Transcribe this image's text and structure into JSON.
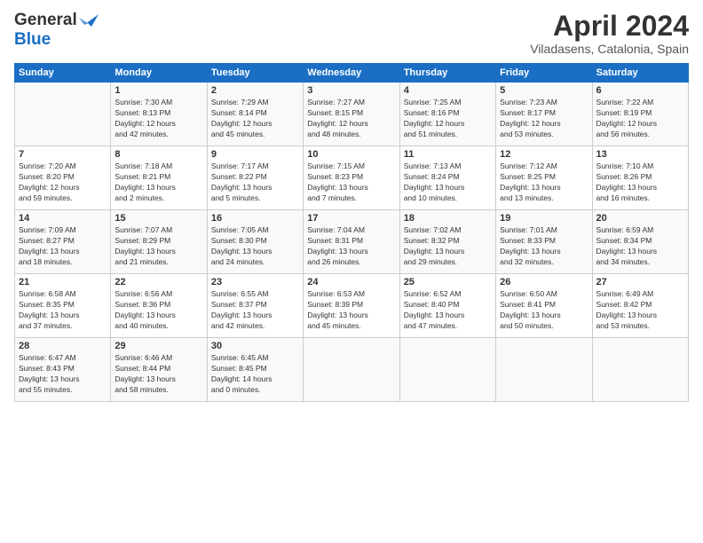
{
  "header": {
    "logo_general": "General",
    "logo_blue": "Blue",
    "month": "April 2024",
    "location": "Viladasens, Catalonia, Spain"
  },
  "days_of_week": [
    "Sunday",
    "Monday",
    "Tuesday",
    "Wednesday",
    "Thursday",
    "Friday",
    "Saturday"
  ],
  "weeks": [
    [
      {
        "day": "",
        "info": ""
      },
      {
        "day": "1",
        "info": "Sunrise: 7:30 AM\nSunset: 8:13 PM\nDaylight: 12 hours\nand 42 minutes."
      },
      {
        "day": "2",
        "info": "Sunrise: 7:29 AM\nSunset: 8:14 PM\nDaylight: 12 hours\nand 45 minutes."
      },
      {
        "day": "3",
        "info": "Sunrise: 7:27 AM\nSunset: 8:15 PM\nDaylight: 12 hours\nand 48 minutes."
      },
      {
        "day": "4",
        "info": "Sunrise: 7:25 AM\nSunset: 8:16 PM\nDaylight: 12 hours\nand 51 minutes."
      },
      {
        "day": "5",
        "info": "Sunrise: 7:23 AM\nSunset: 8:17 PM\nDaylight: 12 hours\nand 53 minutes."
      },
      {
        "day": "6",
        "info": "Sunrise: 7:22 AM\nSunset: 8:19 PM\nDaylight: 12 hours\nand 56 minutes."
      }
    ],
    [
      {
        "day": "7",
        "info": "Sunrise: 7:20 AM\nSunset: 8:20 PM\nDaylight: 12 hours\nand 59 minutes."
      },
      {
        "day": "8",
        "info": "Sunrise: 7:18 AM\nSunset: 8:21 PM\nDaylight: 13 hours\nand 2 minutes."
      },
      {
        "day": "9",
        "info": "Sunrise: 7:17 AM\nSunset: 8:22 PM\nDaylight: 13 hours\nand 5 minutes."
      },
      {
        "day": "10",
        "info": "Sunrise: 7:15 AM\nSunset: 8:23 PM\nDaylight: 13 hours\nand 7 minutes."
      },
      {
        "day": "11",
        "info": "Sunrise: 7:13 AM\nSunset: 8:24 PM\nDaylight: 13 hours\nand 10 minutes."
      },
      {
        "day": "12",
        "info": "Sunrise: 7:12 AM\nSunset: 8:25 PM\nDaylight: 13 hours\nand 13 minutes."
      },
      {
        "day": "13",
        "info": "Sunrise: 7:10 AM\nSunset: 8:26 PM\nDaylight: 13 hours\nand 16 minutes."
      }
    ],
    [
      {
        "day": "14",
        "info": "Sunrise: 7:09 AM\nSunset: 8:27 PM\nDaylight: 13 hours\nand 18 minutes."
      },
      {
        "day": "15",
        "info": "Sunrise: 7:07 AM\nSunset: 8:29 PM\nDaylight: 13 hours\nand 21 minutes."
      },
      {
        "day": "16",
        "info": "Sunrise: 7:05 AM\nSunset: 8:30 PM\nDaylight: 13 hours\nand 24 minutes."
      },
      {
        "day": "17",
        "info": "Sunrise: 7:04 AM\nSunset: 8:31 PM\nDaylight: 13 hours\nand 26 minutes."
      },
      {
        "day": "18",
        "info": "Sunrise: 7:02 AM\nSunset: 8:32 PM\nDaylight: 13 hours\nand 29 minutes."
      },
      {
        "day": "19",
        "info": "Sunrise: 7:01 AM\nSunset: 8:33 PM\nDaylight: 13 hours\nand 32 minutes."
      },
      {
        "day": "20",
        "info": "Sunrise: 6:59 AM\nSunset: 8:34 PM\nDaylight: 13 hours\nand 34 minutes."
      }
    ],
    [
      {
        "day": "21",
        "info": "Sunrise: 6:58 AM\nSunset: 8:35 PM\nDaylight: 13 hours\nand 37 minutes."
      },
      {
        "day": "22",
        "info": "Sunrise: 6:56 AM\nSunset: 8:36 PM\nDaylight: 13 hours\nand 40 minutes."
      },
      {
        "day": "23",
        "info": "Sunrise: 6:55 AM\nSunset: 8:37 PM\nDaylight: 13 hours\nand 42 minutes."
      },
      {
        "day": "24",
        "info": "Sunrise: 6:53 AM\nSunset: 8:39 PM\nDaylight: 13 hours\nand 45 minutes."
      },
      {
        "day": "25",
        "info": "Sunrise: 6:52 AM\nSunset: 8:40 PM\nDaylight: 13 hours\nand 47 minutes."
      },
      {
        "day": "26",
        "info": "Sunrise: 6:50 AM\nSunset: 8:41 PM\nDaylight: 13 hours\nand 50 minutes."
      },
      {
        "day": "27",
        "info": "Sunrise: 6:49 AM\nSunset: 8:42 PM\nDaylight: 13 hours\nand 53 minutes."
      }
    ],
    [
      {
        "day": "28",
        "info": "Sunrise: 6:47 AM\nSunset: 8:43 PM\nDaylight: 13 hours\nand 55 minutes."
      },
      {
        "day": "29",
        "info": "Sunrise: 6:46 AM\nSunset: 8:44 PM\nDaylight: 13 hours\nand 58 minutes."
      },
      {
        "day": "30",
        "info": "Sunrise: 6:45 AM\nSunset: 8:45 PM\nDaylight: 14 hours\nand 0 minutes."
      },
      {
        "day": "",
        "info": ""
      },
      {
        "day": "",
        "info": ""
      },
      {
        "day": "",
        "info": ""
      },
      {
        "day": "",
        "info": ""
      }
    ]
  ]
}
